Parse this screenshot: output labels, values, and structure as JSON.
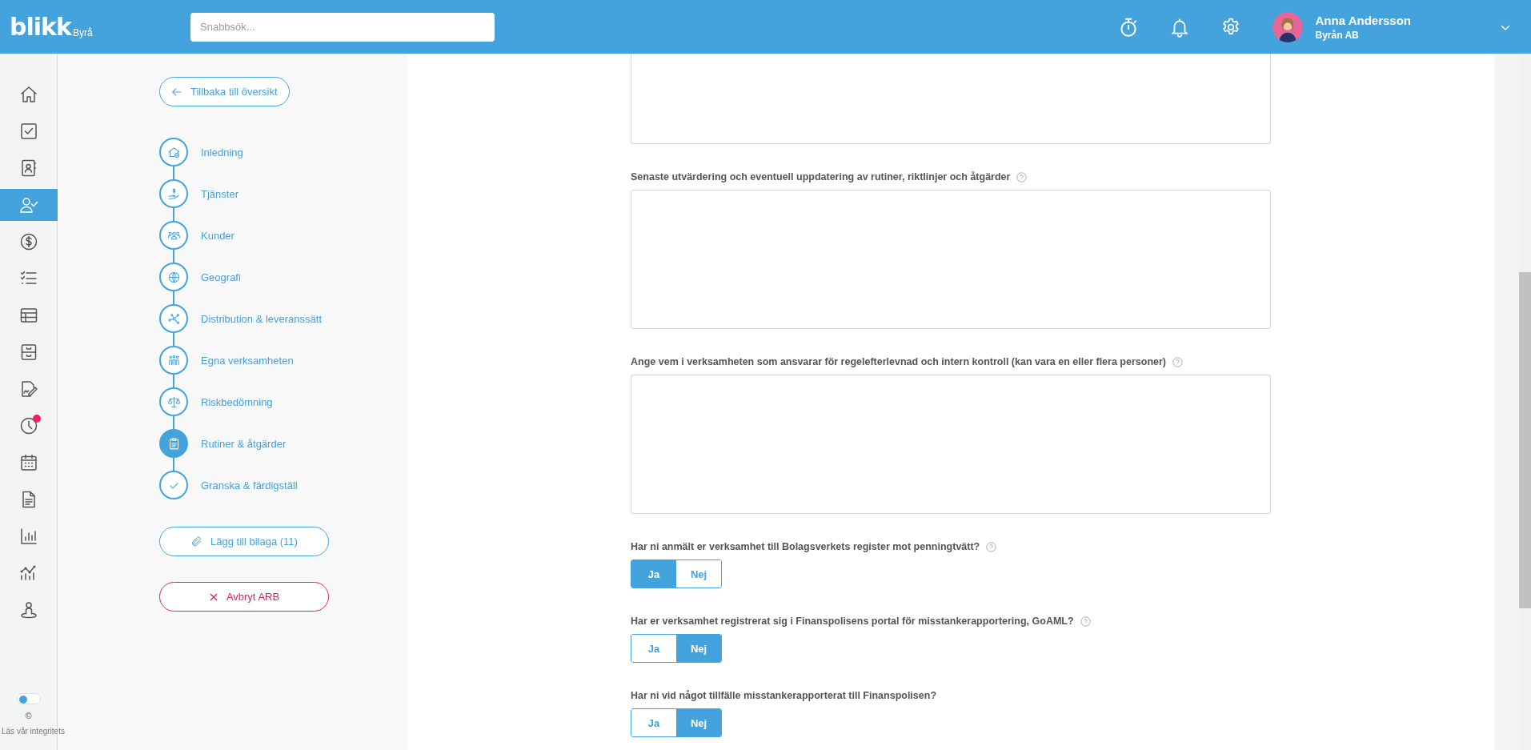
{
  "header": {
    "logo": "blikk",
    "logo_suffix": "Byrå",
    "search": {
      "placeholder": "Snabbsök..."
    },
    "user": {
      "name": "Anna Andersson",
      "company": "Byrån AB"
    }
  },
  "nav": {
    "items": [
      {
        "selected": false,
        "notification": false
      },
      {
        "selected": false,
        "notification": false
      },
      {
        "selected": false,
        "notification": false
      },
      {
        "selected": true,
        "notification": false
      },
      {
        "selected": false,
        "notification": false
      },
      {
        "selected": false,
        "notification": false
      },
      {
        "selected": false,
        "notification": false
      },
      {
        "selected": false,
        "notification": false
      },
      {
        "selected": false,
        "notification": false
      },
      {
        "selected": false,
        "notification": true
      },
      {
        "selected": false,
        "notification": false
      },
      {
        "selected": false,
        "notification": false
      },
      {
        "selected": false,
        "notification": false
      },
      {
        "selected": false,
        "notification": false
      },
      {
        "selected": false,
        "notification": false
      }
    ],
    "toggle": {
      "on": false
    },
    "copyright": "©",
    "privacy_link": "Läs vår integritets"
  },
  "steps": {
    "back_button": "Tillbaka till översikt",
    "items": [
      {
        "label": "Inledning",
        "selected": false
      },
      {
        "label": "Tjänster",
        "selected": false
      },
      {
        "label": "Kunder",
        "selected": false
      },
      {
        "label": "Geografi",
        "selected": false
      },
      {
        "label": "Distribution & leveranssätt",
        "selected": false
      },
      {
        "label": "Egna verksamheten",
        "selected": false
      },
      {
        "label": "Riskbedömning",
        "selected": false
      },
      {
        "label": "Rutiner & åtgärder",
        "selected": true
      },
      {
        "label": "Granska & färdigställ",
        "selected": false
      }
    ],
    "attach_button": "Lägg till bilaga (11)",
    "cancel_button": "Avbryt ARB"
  },
  "form": {
    "fields": [
      {
        "kind": "textarea"
      },
      {
        "kind": "textarea",
        "label": "Senaste utvärdering och eventuell uppdatering av rutiner, riktlinjer och åtgärder",
        "help": true
      },
      {
        "kind": "textarea",
        "label": "Ange vem i verksamheten som ansvarar för regelefterlevnad och intern kontroll (kan vara en eller flera personer)",
        "help": true
      },
      {
        "kind": "yesno",
        "label": "Har ni anmält er verksamhet till Bolagsverkets register mot penningtvätt?",
        "help": true,
        "options": [
          {
            "label": "Ja",
            "selected": true
          },
          {
            "label": "Nej",
            "selected": false
          }
        ]
      },
      {
        "kind": "yesno",
        "label": "Har er verksamhet registrerat sig i Finanspolisens portal för misstankerapportering, GoAML?",
        "help": true,
        "options": [
          {
            "label": "Ja",
            "selected": false
          },
          {
            "label": "Nej",
            "selected": true
          }
        ]
      },
      {
        "kind": "yesno",
        "label": "Har ni vid något tillfälle misstankerapporterat till Finanspolisen?",
        "help": false,
        "options": [
          {
            "label": "Ja",
            "selected": false
          },
          {
            "label": "Nej",
            "selected": true
          }
        ]
      }
    ]
  }
}
